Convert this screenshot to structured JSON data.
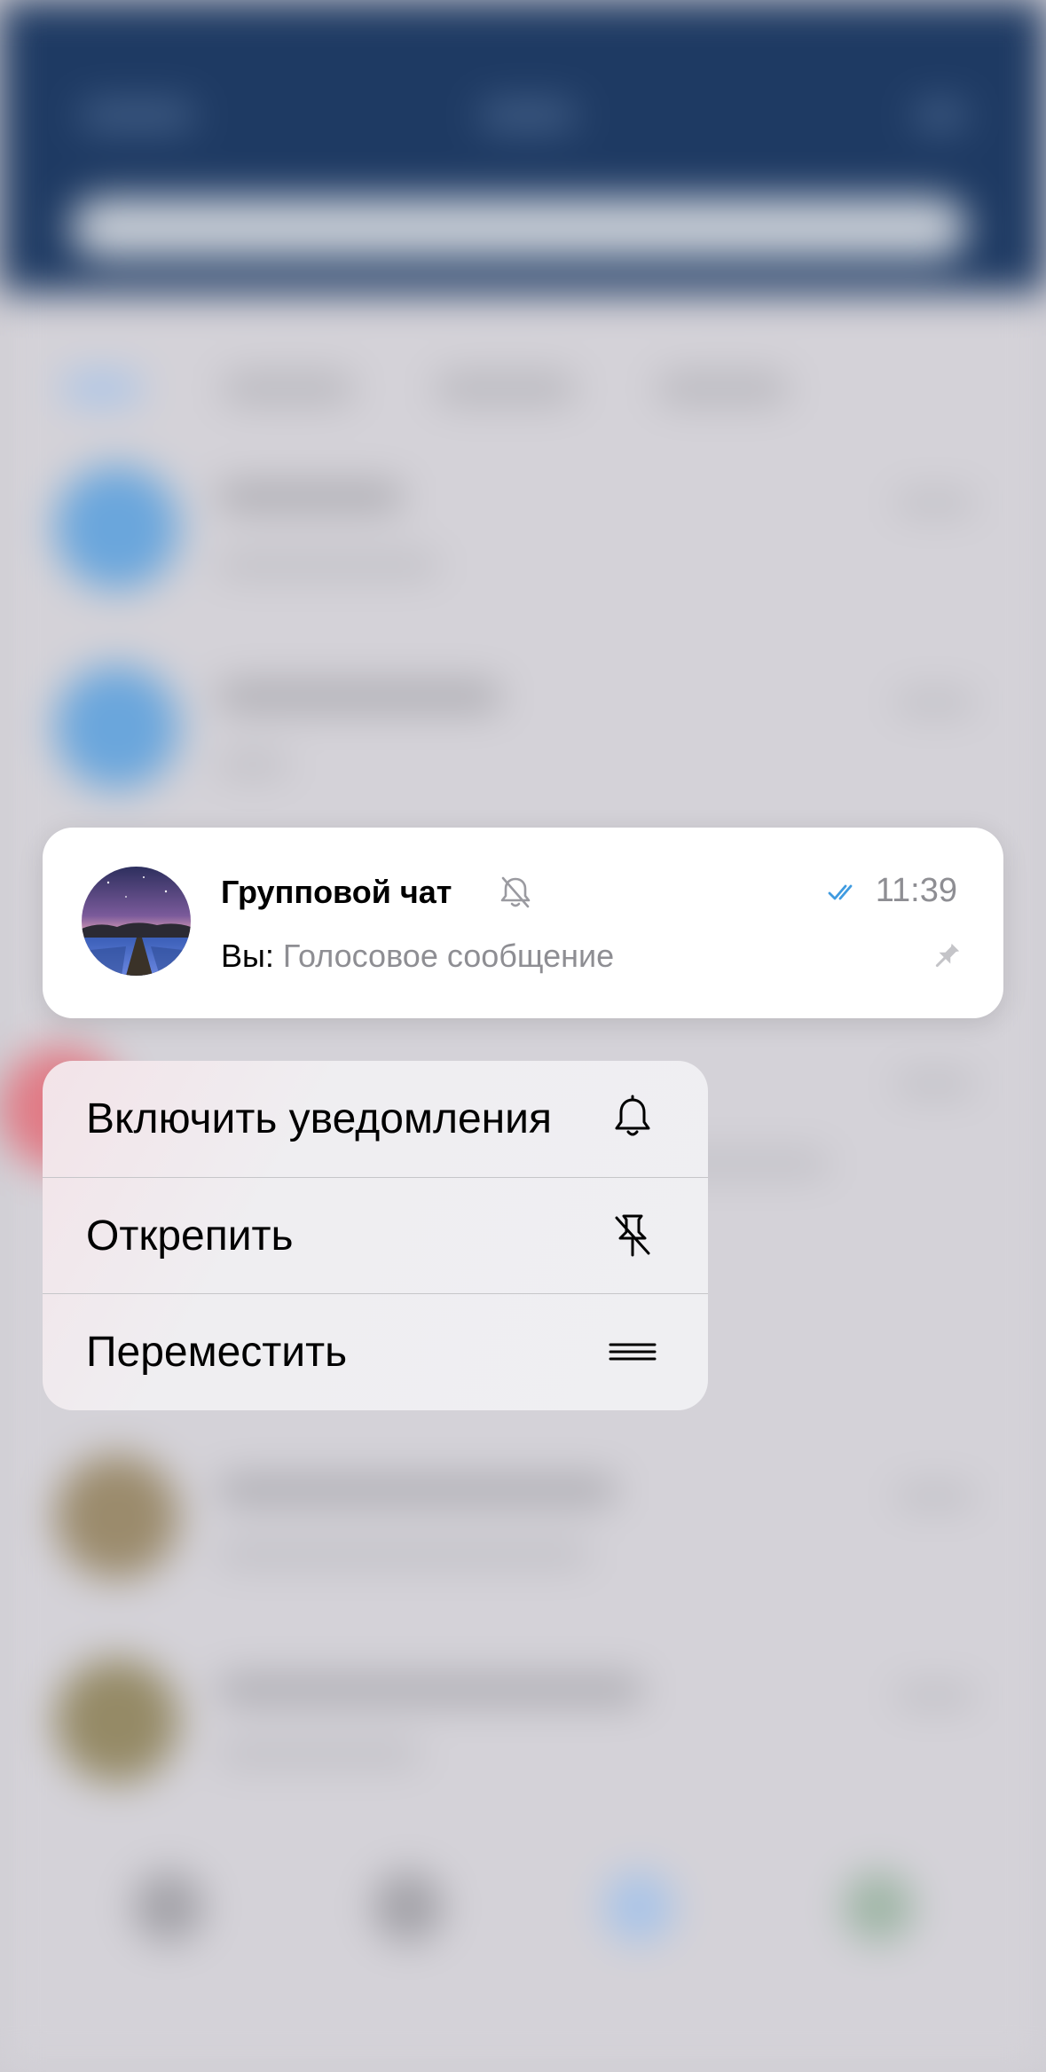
{
  "chat": {
    "title": "Групповой чат",
    "time": "11:39",
    "sender": "Вы:",
    "message": "Голосовое сообщение",
    "muted": true,
    "pinned": true,
    "read": true,
    "accent_color": "#3f9be0"
  },
  "menu": {
    "items": [
      {
        "label": "Включить уведомления",
        "icon": "bell-icon"
      },
      {
        "label": "Открепить",
        "icon": "unpin-icon"
      },
      {
        "label": "Переместить",
        "icon": "reorder-icon"
      }
    ]
  },
  "colors": {
    "header": "#1e3a63",
    "card": "#ffffff",
    "secondary_text": "#8e8e93"
  }
}
